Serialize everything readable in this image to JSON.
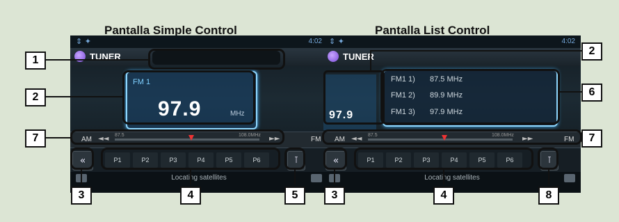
{
  "headings": {
    "left": "Pantalla Simple Control",
    "right": "Pantalla List Control"
  },
  "left_screen": {
    "status_icons": "⇕ ✦",
    "time": "4:02",
    "title": "TUNER",
    "band": "FM 1",
    "frequency": "97.9",
    "unit": "MHz",
    "seek": {
      "left": "AM",
      "right": "FM",
      "prev": "◄◄",
      "next": "►►",
      "scale_start": "87.5",
      "scale_end": "108.0MHz"
    },
    "back_label": "«",
    "util_label": "⊺",
    "presets": [
      "P1",
      "P2",
      "P3",
      "P4",
      "P5",
      "P6"
    ],
    "gps_text": "Locating satellites"
  },
  "right_screen": {
    "status_icons": "⇕ ✦",
    "time": "4:02",
    "title": "TUNER",
    "frequency": "97.9",
    "preset_list": [
      {
        "label": "FM1 1)",
        "value": "87.5  MHz"
      },
      {
        "label": "FM1 2)",
        "value": "89.9  MHz"
      },
      {
        "label": "FM1 3)",
        "value": "97.9  MHz"
      }
    ],
    "seek": {
      "left": "AM",
      "right": "FM",
      "prev": "◄◄",
      "next": "►►",
      "scale_start": "87.5",
      "scale_end": "108.0MHz"
    },
    "back_label": "«",
    "util_label": "⊺",
    "presets": [
      "P1",
      "P2",
      "P3",
      "P4",
      "P5",
      "P6"
    ],
    "gps_text": "Locating satellites"
  },
  "callouts": {
    "c1": "1",
    "c2l": "2",
    "c2r": "2",
    "c3l": "3",
    "c3r": "3",
    "c4l": "4",
    "c4r": "4",
    "c5": "5",
    "c6": "6",
    "c7l": "7",
    "c7r": "7",
    "c8": "8"
  },
  "colors": {
    "background": "#dce5d4",
    "glow": "#8fd8ff",
    "marker": "#ee3333"
  }
}
